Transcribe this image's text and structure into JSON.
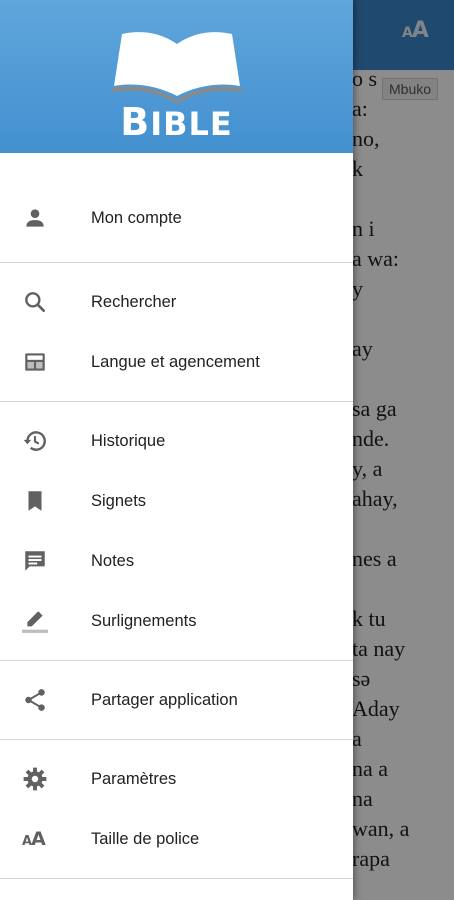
{
  "reader": {
    "version_chip": "Mbuko",
    "verse_lines": [
      "o s",
      "a:",
      "no,",
      "k",
      "",
      "n i",
      "a wa:",
      "y",
      "",
      "ay",
      "",
      "sa ga",
      "nde.",
      "y, a",
      "ahay,",
      "",
      "nes a",
      "",
      "k tu",
      "ta nay",
      "sə",
      "Aday",
      "a",
      "na a",
      "na",
      "wan, a",
      "rapa"
    ]
  },
  "header": {
    "logo_text_big": "B",
    "logo_text_rest": "IBLE"
  },
  "menu": {
    "sections": [
      [
        {
          "label": "Mon compte",
          "icon": "person-icon"
        }
      ],
      [
        {
          "label": "Rechercher",
          "icon": "search-icon"
        },
        {
          "label": "Langue et agencement",
          "icon": "layout-icon"
        }
      ],
      [
        {
          "label": "Historique",
          "icon": "history-icon"
        },
        {
          "label": "Signets",
          "icon": "bookmark-icon"
        },
        {
          "label": "Notes",
          "icon": "note-icon"
        },
        {
          "label": "Surlignements",
          "icon": "highlight-pen-icon"
        }
      ],
      [
        {
          "label": "Partager application",
          "icon": "share-icon"
        }
      ],
      [
        {
          "label": "Paramètres",
          "icon": "gear-icon"
        },
        {
          "label": "Taille de police",
          "icon": "font-size-icon"
        }
      ]
    ]
  },
  "colors": {
    "header_blue": "#4a96d3",
    "icon_gray": "#616161",
    "divider": "#d6d6d6"
  }
}
